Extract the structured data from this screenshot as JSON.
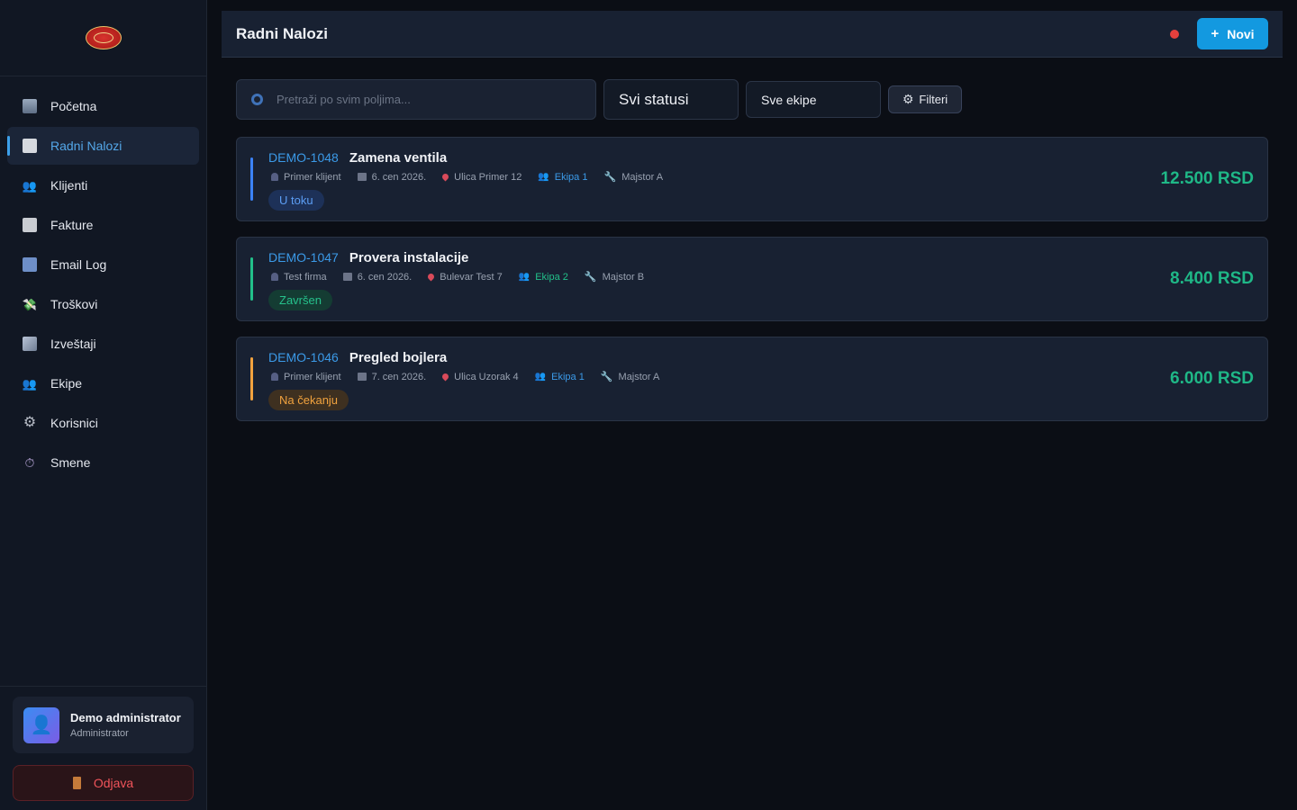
{
  "sidebar": {
    "items": [
      {
        "label": "Početna",
        "icon": "chart-icon"
      },
      {
        "label": "Radni Nalozi",
        "icon": "document-icon",
        "active": true
      },
      {
        "label": "Klijenti",
        "icon": "users-icon"
      },
      {
        "label": "Fakture",
        "icon": "invoice-icon"
      },
      {
        "label": "Email Log",
        "icon": "mail-icon"
      },
      {
        "label": "Troškovi",
        "icon": "money-icon"
      },
      {
        "label": "Izveštaji",
        "icon": "trend-icon"
      },
      {
        "label": "Ekipe",
        "icon": "users-icon"
      },
      {
        "label": "Korisnici",
        "icon": "gear-icon"
      },
      {
        "label": "Smene",
        "icon": "timer-icon"
      }
    ],
    "user": {
      "name": "Demo administrator",
      "role": "Administrator"
    },
    "logout_label": "Odjava"
  },
  "header": {
    "title": "Radni Nalozi",
    "new_button_label": "Novi",
    "status_color": "#e5403d",
    "accent_color": "#1399e0"
  },
  "filters": {
    "search_placeholder": "Pretraži po svim poljima...",
    "status_select": "Svi statusi",
    "team_select": "Sve ekipe",
    "filters_button": "Filteri"
  },
  "orders": [
    {
      "id": "DEMO-1048",
      "title": "Zamena ventila",
      "client": "Primer klijent",
      "date": "6. cen 2026.",
      "address": "Ulica Primer 12",
      "team": "Ekipa 1",
      "worker": "Majstor A",
      "status": "U toku",
      "status_color": "#3b82f6",
      "amount": "12.500 RSD"
    },
    {
      "id": "DEMO-1047",
      "title": "Provera instalacije",
      "client": "Test firma",
      "date": "6. cen 2026.",
      "address": "Bulevar Test 7",
      "team": "Ekipa 2",
      "worker": "Majstor B",
      "status": "Završen",
      "status_color": "#22c08a",
      "amount": "8.400 RSD"
    },
    {
      "id": "DEMO-1046",
      "title": "Pregled bojlera",
      "client": "Primer klijent",
      "date": "7. cen 2026.",
      "address": "Ulica Uzorak 4",
      "team": "Ekipa 1",
      "worker": "Majstor A",
      "status": "Na čekanju",
      "status_color": "#f1a23e",
      "amount": "6.000 RSD"
    }
  ]
}
